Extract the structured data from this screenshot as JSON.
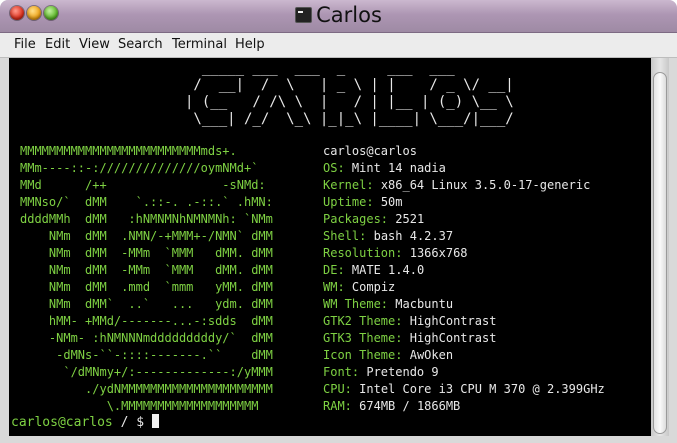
{
  "window": {
    "title": "Carlos",
    "title_icon": "terminal-icon"
  },
  "menu": [
    "File",
    "Edit",
    "View",
    "Search",
    "Terminal",
    "Help"
  ],
  "banner": [
    " /  __|  /  \\   | _ \\ | |    / _ \\/ __| ",
    "| (__   / /\\ \\  |   / | |__ | (_) \\__ \\ ",
    " \\___| /_/  \\_\\ |_|_\\ |____| \\___/|___/ "
  ],
  "ascii_logo": [
    "MMMMMMMMMMMMMMMMMMMMMMMMMmds+.",
    "MMm----::-://////////////oymNMd+`",
    "MMd      /++                -sNMd:",
    "MMNso/`  dMM    `.::-. .-::.` .hMN:",
    "ddddMMh  dMM   :hNMNMNhNMNMNh: `NMm",
    "    NMm  dMM  .NMN/-+MMM+-/NMN` dMM",
    "    NMm  dMM  -MMm  `MMM   dMM. dMM",
    "    NMm  dMM  -MMm  `MMM   dMM. dMM",
    "    NMm  dMM  .mmd  `mmm   yMM. dMM",
    "    NMm  dMM`  ..`   ...   ydm. dMM",
    "    hMM- +MMd/-------...-:sdds  dMM",
    "    -NMm- :hNMNNNmdddddddddy/`  dMM",
    "     -dMNs-``-::::-------.``    dMM",
    "      `/dMNmy+/:-------------:/yMMM",
    "         ./ydNMMMMMMMMMMMMMMMMMMMMM",
    "            \\.MMMMMMMMMMMMMMMMMMM"
  ],
  "user_host": "carlos@carlos",
  "info": [
    {
      "key": "OS:",
      "value": "Mint 14 nadia"
    },
    {
      "key": "Kernel:",
      "value": "x86_64 Linux 3.5.0-17-generic"
    },
    {
      "key": "Uptime:",
      "value": "50m"
    },
    {
      "key": "Packages:",
      "value": "2521"
    },
    {
      "key": "Shell:",
      "value": "bash 4.2.37"
    },
    {
      "key": "Resolution:",
      "value": "1366x768"
    },
    {
      "key": "DE:",
      "value": "MATE 1.4.0"
    },
    {
      "key": "WM:",
      "value": "Compiz"
    },
    {
      "key": "WM Theme:",
      "value": "Macbuntu"
    },
    {
      "key": "GTK2 Theme:",
      "value": "HighContrast"
    },
    {
      "key": "GTK3 Theme:",
      "value": "HighContrast"
    },
    {
      "key": "Icon Theme:",
      "value": "AwOken"
    },
    {
      "key": "Font:",
      "value": "Pretendo 9"
    },
    {
      "key": "CPU:",
      "value": "Intel Core i3 CPU M 370 @ 2.399GHz"
    },
    {
      "key": "RAM:",
      "value": "674MB / 1866MB"
    }
  ],
  "prompt": {
    "user": "carlos@carlos",
    "path": " / $ "
  },
  "colors": {
    "green": "#7ed143",
    "text": "#e8e8e8",
    "background": "#000000",
    "titlebar": "#ad96b3"
  }
}
